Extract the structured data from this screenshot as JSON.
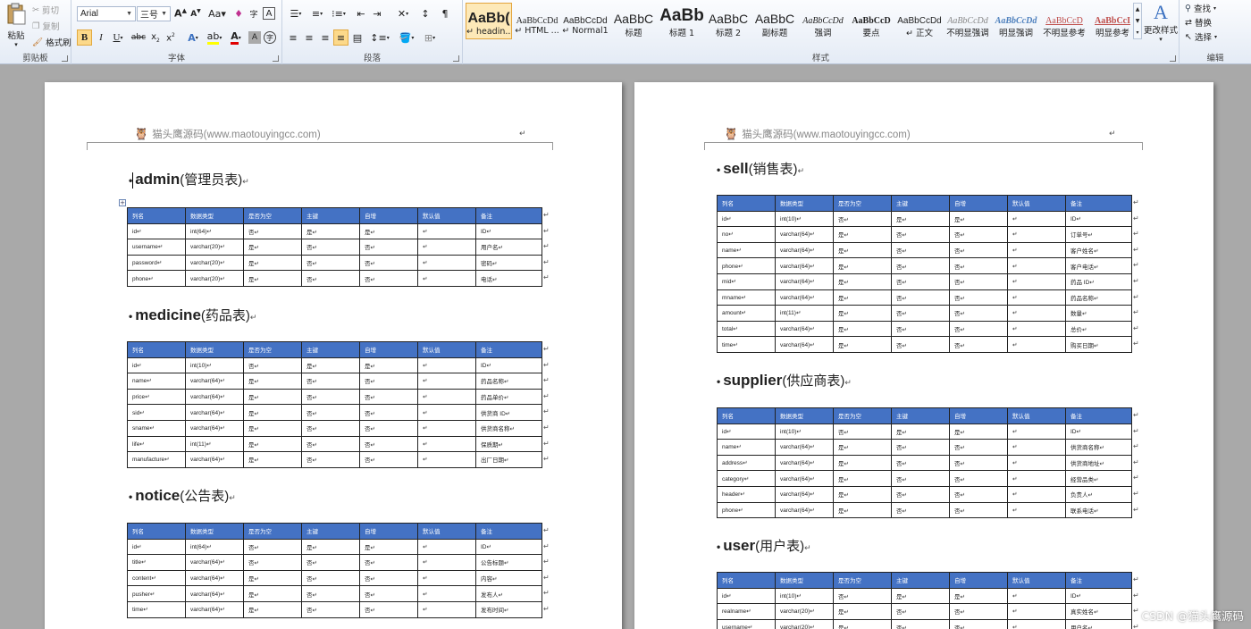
{
  "ribbon": {
    "clipboard": {
      "paste": "粘贴",
      "cut": "剪切",
      "copy": "复制",
      "format_painter": "格式刷",
      "group_label": "剪贴板"
    },
    "font": {
      "font_name": "Arial",
      "font_size": "三号",
      "group_label": "字体"
    },
    "paragraph": {
      "group_label": "段落"
    },
    "styles": {
      "group_label": "样式",
      "items": [
        {
          "preview": "AaBb(",
          "name": "↵ headin..."
        },
        {
          "preview": "AaBbCcDd",
          "name": "↵ HTML ..."
        },
        {
          "preview": "AaBbCcDd",
          "name": "↵ Normal1"
        },
        {
          "preview": "AaBbC",
          "name": "标题"
        },
        {
          "preview": "AaBb",
          "name": "标题 1"
        },
        {
          "preview": "AaBbC",
          "name": "标题 2"
        },
        {
          "preview": "AaBbC",
          "name": "副标题"
        },
        {
          "preview": "AaBbCcDd",
          "name": "强调"
        },
        {
          "preview": "AaBbCcD",
          "name": "要点"
        },
        {
          "preview": "AaBbCcDd",
          "name": "↵ 正文"
        },
        {
          "preview": "AaBbCcDd",
          "name": "不明显强调"
        },
        {
          "preview": "AaBbCcDd",
          "name": "明显强调"
        },
        {
          "preview": "AaBbCcD",
          "name": "不明显参考"
        },
        {
          "preview": "AaBbCcI",
          "name": "明显参考"
        }
      ],
      "change_styles": "更改样式"
    },
    "editing": {
      "find": "查找",
      "replace": "替换",
      "select": "选择",
      "group_label": "编辑"
    }
  },
  "document": {
    "header_text": "猫头鹰源码(www.maotouyingcc.com)",
    "columns": [
      "列名",
      "数据类型",
      "是否为空",
      "主键",
      "自增",
      "默认值",
      "备注"
    ],
    "tables": [
      {
        "name": "admin",
        "cn": "(管理员表)",
        "rows": [
          [
            "id↵",
            "int(64)↵",
            "否↵",
            "是↵",
            "是↵",
            "↵",
            "ID↵"
          ],
          [
            "username↵",
            "varchar(20)↵",
            "是↵",
            "否↵",
            "否↵",
            "↵",
            "用户名↵"
          ],
          [
            "password↵",
            "varchar(20)↵",
            "是↵",
            "否↵",
            "否↵",
            "↵",
            "密码↵"
          ],
          [
            "phone↵",
            "varchar(20)↵",
            "是↵",
            "否↵",
            "否↵",
            "↵",
            "电话↵"
          ]
        ]
      },
      {
        "name": "medicine",
        "cn": "(药品表)",
        "rows": [
          [
            "id↵",
            "int(10)↵",
            "否↵",
            "是↵",
            "是↵",
            "↵",
            "ID↵"
          ],
          [
            "name↵",
            "varchar(64)↵",
            "是↵",
            "否↵",
            "否↵",
            "↵",
            "药品名称↵"
          ],
          [
            "price↵",
            "varchar(64)↵",
            "是↵",
            "否↵",
            "否↵",
            "↵",
            "药品单价↵"
          ],
          [
            "sid↵",
            "varchar(64)↵",
            "是↵",
            "否↵",
            "否↵",
            "↵",
            "供货商 ID↵"
          ],
          [
            "sname↵",
            "varchar(64)↵",
            "是↵",
            "否↵",
            "否↵",
            "↵",
            "供货商名称↵"
          ],
          [
            "life↵",
            "int(11)↵",
            "是↵",
            "否↵",
            "否↵",
            "↵",
            "保质期↵"
          ],
          [
            "manufacture↵",
            "varchar(64)↵",
            "是↵",
            "否↵",
            "否↵",
            "↵",
            "出厂日期↵"
          ]
        ]
      },
      {
        "name": "notice",
        "cn": "(公告表)",
        "rows": [
          [
            "id↵",
            "int(64)↵",
            "否↵",
            "是↵",
            "是↵",
            "↵",
            "ID↵"
          ],
          [
            "title↵",
            "varchar(64)↵",
            "否↵",
            "否↵",
            "否↵",
            "↵",
            "公告标题↵"
          ],
          [
            "content↵",
            "varchar(64)↵",
            "是↵",
            "否↵",
            "否↵",
            "↵",
            "内容↵"
          ],
          [
            "pusher↵",
            "varchar(64)↵",
            "是↵",
            "否↵",
            "否↵",
            "↵",
            "发布人↵"
          ],
          [
            "time↵",
            "varchar(64)↵",
            "是↵",
            "否↵",
            "否↵",
            "↵",
            "发布时间↵"
          ]
        ]
      },
      {
        "name": "sell",
        "cn": "(销售表)",
        "rows": [
          [
            "id↵",
            "int(10)↵",
            "否↵",
            "是↵",
            "是↵",
            "↵",
            "ID↵"
          ],
          [
            "no↵",
            "varchar(64)↵",
            "是↵",
            "否↵",
            "否↵",
            "↵",
            "订单号↵"
          ],
          [
            "name↵",
            "varchar(64)↵",
            "是↵",
            "否↵",
            "否↵",
            "↵",
            "客户姓名↵"
          ],
          [
            "phone↵",
            "varchar(64)↵",
            "是↵",
            "否↵",
            "否↵",
            "↵",
            "客户电话↵"
          ],
          [
            "mid↵",
            "varchar(64)↵",
            "是↵",
            "否↵",
            "否↵",
            "↵",
            "药品 ID↵"
          ],
          [
            "mname↵",
            "varchar(64)↵",
            "是↵",
            "否↵",
            "否↵",
            "↵",
            "药品名称↵"
          ],
          [
            "amount↵",
            "int(11)↵",
            "是↵",
            "否↵",
            "否↵",
            "↵",
            "数量↵"
          ],
          [
            "total↵",
            "varchar(64)↵",
            "是↵",
            "否↵",
            "否↵",
            "↵",
            "总价↵"
          ],
          [
            "time↵",
            "varchar(64)↵",
            "是↵",
            "否↵",
            "否↵",
            "↵",
            "购买日期↵"
          ]
        ]
      },
      {
        "name": "supplier",
        "cn": "(供应商表)",
        "rows": [
          [
            "id↵",
            "int(10)↵",
            "否↵",
            "是↵",
            "是↵",
            "↵",
            "ID↵"
          ],
          [
            "name↵",
            "varchar(64)↵",
            "是↵",
            "否↵",
            "否↵",
            "↵",
            "供货商名称↵"
          ],
          [
            "address↵",
            "varchar(64)↵",
            "是↵",
            "否↵",
            "否↵",
            "↵",
            "供货商地址↵"
          ],
          [
            "category↵",
            "varchar(64)↵",
            "是↵",
            "否↵",
            "否↵",
            "↵",
            "经营品类↵"
          ],
          [
            "header↵",
            "varchar(64)↵",
            "是↵",
            "否↵",
            "否↵",
            "↵",
            "负责人↵"
          ],
          [
            "phone↵",
            "varchar(64)↵",
            "是↵",
            "否↵",
            "否↵",
            "↵",
            "联系电话↵"
          ]
        ]
      },
      {
        "name": "user",
        "cn": "(用户表)",
        "rows": [
          [
            "id↵",
            "int(10)↵",
            "否↵",
            "是↵",
            "是↵",
            "↵",
            "ID↵"
          ],
          [
            "realname↵",
            "varchar(20)↵",
            "是↵",
            "否↵",
            "否↵",
            "↵",
            "真实姓名↵"
          ],
          [
            "username↵",
            "varchar(20)↵",
            "是↵",
            "否↵",
            "否↵",
            "↵",
            "用户名↵"
          ]
        ]
      }
    ]
  },
  "watermark": "CSDN @猫头鹰源码",
  "colors": {
    "table_header": "#4472c4",
    "accent": "#fcd98a"
  }
}
